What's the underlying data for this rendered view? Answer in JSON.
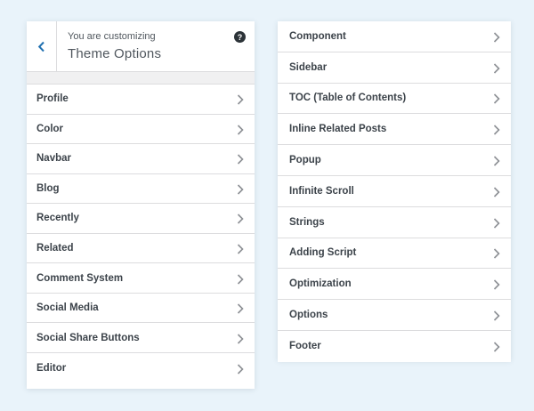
{
  "left_panel": {
    "header": {
      "subtitle": "You are customizing",
      "title": "Theme Options",
      "help_label": "?"
    },
    "items": [
      {
        "label": "Profile"
      },
      {
        "label": "Color"
      },
      {
        "label": "Navbar"
      },
      {
        "label": "Blog"
      },
      {
        "label": "Recently"
      },
      {
        "label": "Related"
      },
      {
        "label": "Comment System"
      },
      {
        "label": "Social Media"
      },
      {
        "label": "Social Share Buttons"
      },
      {
        "label": "Editor"
      }
    ]
  },
  "right_panel": {
    "items": [
      {
        "label": "Component"
      },
      {
        "label": "Sidebar"
      },
      {
        "label": "TOC (Table of Contents)"
      },
      {
        "label": "Inline Related Posts"
      },
      {
        "label": "Popup"
      },
      {
        "label": "Infinite Scroll"
      },
      {
        "label": "Strings"
      },
      {
        "label": "Adding Script"
      },
      {
        "label": "Optimization"
      },
      {
        "label": "Options"
      },
      {
        "label": "Footer"
      }
    ]
  },
  "icons": {
    "back": "chevron-left-icon",
    "help": "help-icon",
    "item_arrow": "chevron-right-icon"
  },
  "colors": {
    "background": "#e9f3fa",
    "accent": "#2271b1",
    "text": "#3c434a",
    "border": "#dcdcde"
  }
}
